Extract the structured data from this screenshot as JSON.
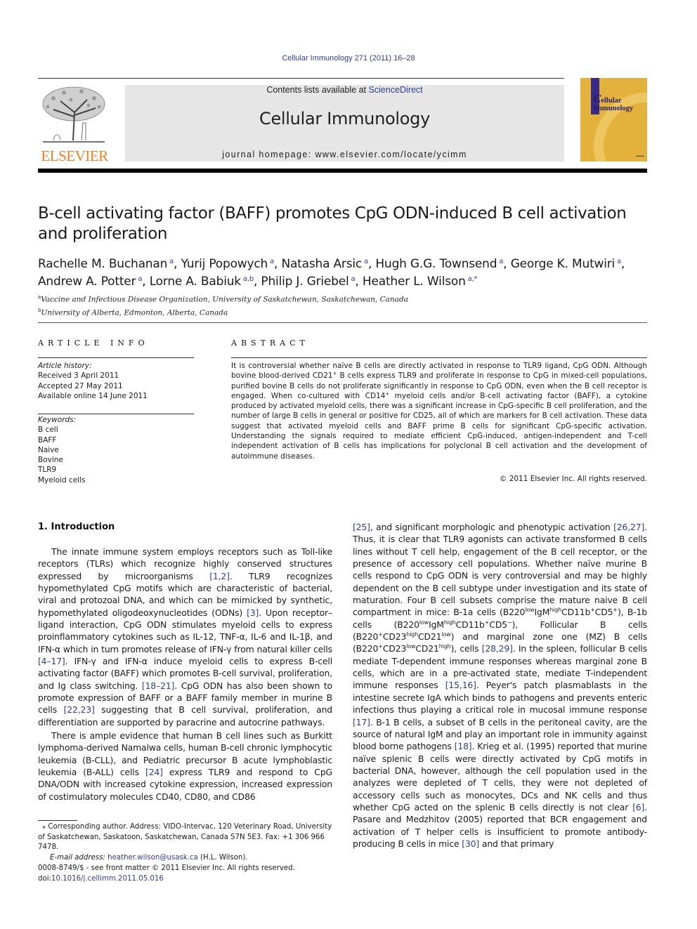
{
  "header": {
    "journal_ref": "Cellular Immunology 271 (2011) 16–28",
    "contents_prefix": "Contents lists available at ",
    "sciencedirect_link": "ScienceDirect",
    "journal_title": "Cellular Immunology",
    "homepage": "journal homepage: www.elsevier.com/locate/ycimm",
    "publisher_logo_text": "ELSEVIER",
    "cover_title_first": "C",
    "cover_title_rest1": "ellular",
    "cover_title_rest2": "Immunology",
    "colors": {
      "link": "#2e3d8f",
      "elsevier_orange": "#f07f1e",
      "cover_gold": "#e3b23c",
      "banner_gray": "#e6e6e6"
    }
  },
  "article": {
    "title_line1": "B-cell activating factor (BAFF) promotes CpG ODN-induced B cell activation",
    "title_line2": "and proliferation",
    "authors": [
      {
        "name": "Rachelle M. Buchanan",
        "aff": "a"
      },
      {
        "name": "Yurij Popowych",
        "aff": "a"
      },
      {
        "name": "Natasha Arsic",
        "aff": "a"
      },
      {
        "name": "Hugh G.G. Townsend",
        "aff": "a"
      },
      {
        "name": "George K. Mutwiri",
        "aff": "a"
      },
      {
        "name": "Andrew A. Potter",
        "aff": "a"
      },
      {
        "name": "Lorne A. Babiuk",
        "aff": "a,b"
      },
      {
        "name": "Philip J. Griebel",
        "aff": "a"
      },
      {
        "name": "Heather L. Wilson",
        "aff": "a,*"
      }
    ],
    "affiliations": [
      {
        "key": "a",
        "text": "Vaccine and Infectious Disease Organization, University of Saskatchewan, Saskatchewan, Canada"
      },
      {
        "key": "b",
        "text": "University of Alberta, Edmonton, Alberta, Canada"
      }
    ]
  },
  "article_info": {
    "heading": "ARTICLE INFO",
    "history_label": "Article history:",
    "history": [
      "Received 3 April 2011",
      "Accepted 27 May 2011",
      "Available online 14 June 2011"
    ],
    "keywords_label": "Keywords:",
    "keywords": [
      "B cell",
      "BAFF",
      "Naive",
      "Bovine",
      "TLR9",
      "Myeloid cells"
    ]
  },
  "abstract": {
    "heading": "ABSTRACT",
    "text_a": "It is controversial whether naïve B cells are directly activated in response to TLR9 ligand, CpG ODN. Although bovine blood-derived CD21",
    "text_b": " B cells express TLR9 and proliferate in response to CpG in mixed-cell populations, purified bovine B cells do not proliferate significantly in response to CpG ODN, even when the B cell receptor is engaged. When co-cultured with CD14",
    "text_c": " myeloid cells and/or B-cell activating factor (BAFF), a cytokine produced by activated myeloid cells, there was a significant increase in CpG-specific B cell proliferation, and the number of large B cells in general or positive for CD25, all of which are markers for B cell activation. These data suggest that activated myeloid cells and BAFF prime B cells for significant CpG-specific activation. Understanding the signals required to mediate efficient CpG-induced, antigen-independent and T-cell independent activation of B cells has implications for polyclonal B cell activation and the development of autoimmune diseases.",
    "plus": "+",
    "copyright": "© 2011 Elsevier Inc. All rights reserved."
  },
  "body": {
    "section_heading": "1. Introduction",
    "p1": [
      {
        "t": "The innate immune system employs receptors such as Toll-like receptors (TLRs) which recognize highly conserved structures expressed by microorganisms "
      },
      {
        "r": "[1,2]"
      },
      {
        "t": ". TLR9 recognizes hypomethylated CpG motifs which are characteristic of bacterial, viral and protozoal DNA, and which can be mimicked by synthetic, hypomethylated oligodeoxynucleotides (ODNs) "
      },
      {
        "r": "[3]"
      },
      {
        "t": ". Upon receptor–ligand interaction, CpG ODN stimulates myeloid cells to express proinflammatory cytokines such as IL-12, TNF-α, IL-6 and IL-1β, and IFN-α which in turn promotes release of IFN-γ from natural killer cells "
      },
      {
        "r": "[4–17]"
      },
      {
        "t": ". IFN-γ and IFN-α induce myeloid cells to express B-cell activating factor (BAFF) which promotes B-cell survival, proliferation, and Ig class switching. "
      },
      {
        "r": "[18–21]"
      },
      {
        "t": ". CpG ODN has also been shown to promote expression of BAFF or a BAFF family member in murine B cells "
      },
      {
        "r": "[22,23]"
      },
      {
        "t": " suggesting that B cell survival, proliferation, and differentiation are supported by paracrine and autocrine pathways."
      }
    ],
    "p2": [
      {
        "t": "There is ample evidence that human B cell lines such as Burkitt lymphoma-derived Namalwa cells, human B-cell chronic lymphocytic leukemia (B-CLL), and Pediatric precursor B acute lymphoblastic leukemia (B-ALL) cells "
      },
      {
        "r": "[24]"
      },
      {
        "t": " express TLR9 and respond to CpG DNA/ODN with increased cytokine expression, increased expression of costimulatory molecules CD40, CD80, and CD86"
      }
    ],
    "col2": [
      {
        "r": "[25]"
      },
      {
        "t": ", and significant morphologic and phenotypic activation "
      },
      {
        "r": "[26,27]"
      },
      {
        "t": ". Thus, it is clear that TLR9 agonists can activate transformed B cells lines without T cell help, engagement of the B cell receptor, or the presence of accessory cell populations. Whether naïve murine B cells respond to CpG ODN is very controversial and may be highly dependent on the B cell subtype under investigation and its state of maturation. Four B cell subsets comprise the mature naive B cell compartment in mice: B-1a cells (B220"
      },
      {
        "s": "low"
      },
      {
        "t": "IgM"
      },
      {
        "s": "high"
      },
      {
        "t": "CD11b"
      },
      {
        "s": "+"
      },
      {
        "t": "CD5"
      },
      {
        "s": "+"
      },
      {
        "t": "), B-1b cells (B220"
      },
      {
        "s": "low"
      },
      {
        "t": "IgM"
      },
      {
        "s": "high"
      },
      {
        "t": "CD11b"
      },
      {
        "s": "+"
      },
      {
        "t": "CD5"
      },
      {
        "s": "−"
      },
      {
        "t": "), Follicular B cells (B220"
      },
      {
        "s": "+"
      },
      {
        "t": "CD23"
      },
      {
        "s": "high"
      },
      {
        "t": "CD21"
      },
      {
        "s": "low"
      },
      {
        "t": ") and marginal zone one (MZ) B cells (B220"
      },
      {
        "s": "+"
      },
      {
        "t": "CD23"
      },
      {
        "s": "low"
      },
      {
        "t": "CD21"
      },
      {
        "s": "high"
      },
      {
        "t": "), cells "
      },
      {
        "r": "[28,29]"
      },
      {
        "t": ". In the spleen, follicular B cells mediate T-dependent immune responses whereas marginal zone B cells, which are in a pre-activated state, mediate T-independent immune responses "
      },
      {
        "r": "[15,16]"
      },
      {
        "t": ". Peyer's patch plasmablasts in the intestine secrete IgA which binds to pathogens and prevents enteric infections thus playing a critical role in mucosal immune response "
      },
      {
        "r": "[17]"
      },
      {
        "t": ". B-1 B cells, a subset of B cells in the peritoneal cavity, are the source of natural IgM and play an important role in immunity against blood borne pathogens "
      },
      {
        "r": "[18]"
      },
      {
        "t": ". Krieg et al. (1995) reported that murine naïve splenic B cells were directly activated by CpG motifs in bacterial DNA, however, although the cell population used in the analyzes were depleted of T cells, they were not depleted of accessory cells such as monocytes, DCs and NK cells and thus whether CpG acted on the splenic B cells directly is not clear "
      },
      {
        "r": "[6]"
      },
      {
        "t": ". Pasare and Medzhitov (2005) reported that BCR engagement and activation of T helper cells is insufficient to promote antibody-producing B cells in mice "
      },
      {
        "r": "[30]"
      },
      {
        "t": " and that primary"
      }
    ]
  },
  "footnote": {
    "star": "⁎",
    "corresponding": " Corresponding author. Address: VIDO-Intervac, 120 Veterinary Road, University of Saskatchewan, Saskatoon, Saskatchewan, Canada S7N 5E3. Fax: +1 306 966 7478.",
    "email_label": "E-mail address: ",
    "email": "heather.wilson@usask.ca",
    "email_suffix": " (H.L. Wilson)."
  },
  "front_matter": {
    "issn_line": "0008-8749/$ - see front matter © 2011 Elsevier Inc. All rights reserved.",
    "doi_prefix": "doi:",
    "doi": "10.1016/j.cellimm.2011.05.016"
  }
}
